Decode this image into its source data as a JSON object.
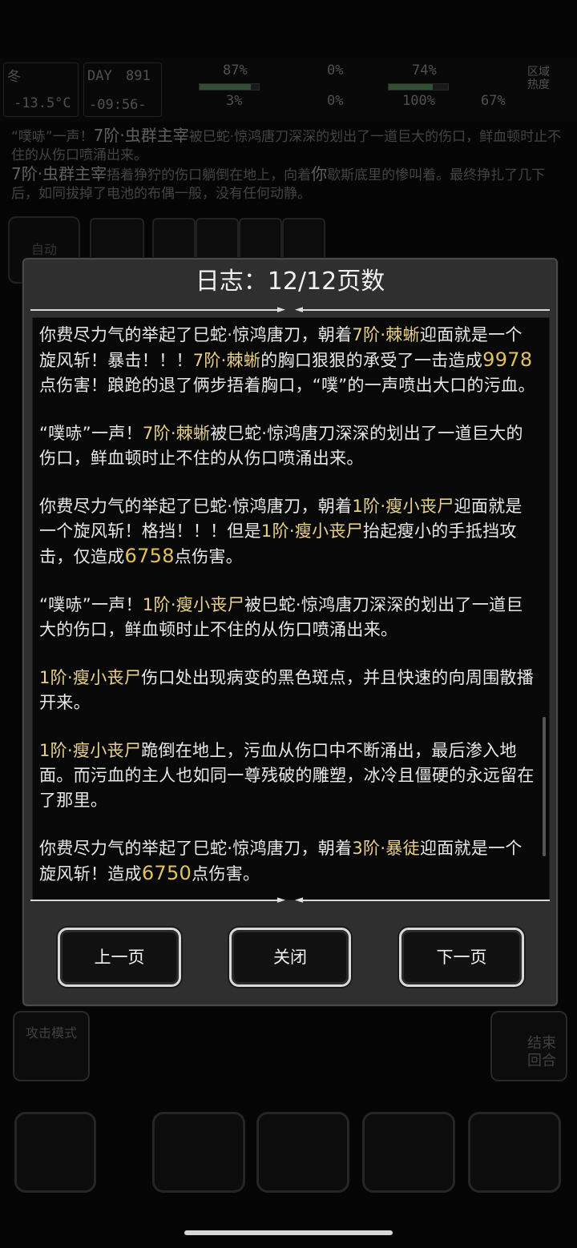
{
  "hud": {
    "temp_label": "冬",
    "temperature": "-13.5°C",
    "day_label": "DAY",
    "day": "891",
    "time": "-09:56-",
    "stats_top": [
      "87%",
      "0%",
      "74%"
    ],
    "stats_bottom": [
      "3%",
      "0%",
      "100%",
      "67%"
    ],
    "region_heat": "区域热度"
  },
  "background_log": {
    "line1_prefix": "“噗哧”一声！",
    "line1_name": "7阶·虫群主宰",
    "line1_rest": "被巳蛇·惊鸿唐刀深深的划出了一道巨大的伤口，鲜血顿时止不住的从伤口喷涌出来。",
    "line2_name": "7阶·虫群主宰",
    "line2_mid": "捂着狰狞的伤口躺倒在地上，向着",
    "line2_you": "你",
    "line2_rest": "歇斯底里的惨叫着。最终挣扎了几下后，如同拔掉了电池的布偶一般，没有任何动静。"
  },
  "side": {
    "auto": "自动",
    "attack_mode": "攻击模式",
    "end_turn": "结束回合"
  },
  "dialog": {
    "title": "日志：12/12页数",
    "entries": [
      {
        "a": "你费尽力气的举起了巳蛇·惊鸿唐刀，朝着",
        "b": "7阶·棘蜥",
        "c": "迎面就是一个旋风斩！暴击！！！",
        "d": "7阶·棘蜥",
        "e": "的胸口狠狠的承受了一击造成",
        "n": "9978",
        "f": "点伤害！踉跄的退了俩步捂着胸口，“噗”的一声喷出大口的污血。"
      },
      {
        "a": "“噗哧”一声！",
        "b": "7阶·棘蜥",
        "c": "被巳蛇·惊鸿唐刀深深的划出了一道巨大的伤口，鲜血顿时止不住的从伤口喷涌出来。"
      },
      {
        "a": "你费尽力气的举起了巳蛇·惊鸿唐刀，朝着",
        "b": "1阶·瘦小丧尸",
        "c": "迎面就是一个旋风斩！格挡！！！但是",
        "d": "1阶·瘦小丧尸",
        "e": "抬起瘦小的手抵挡攻击，仅造成",
        "n": "6758",
        "f": "点伤害。"
      },
      {
        "a": "“噗哧”一声！",
        "b": "1阶·瘦小丧尸",
        "c": "被巳蛇·惊鸿唐刀深深的划出了一道巨大的伤口，鲜血顿时止不住的从伤口喷涌出来。"
      },
      {
        "b": "1阶·瘦小丧尸",
        "c": "伤口处出现病变的黑色斑点，并且快速的向周围散播开来。"
      },
      {
        "b": "1阶·瘦小丧尸",
        "c": "跪倒在地上，污血从伤口中不断涌出，最后渗入地面。而污血的主人也如同一尊残破的雕塑，冰冷且僵硬的永远留在了那里。"
      },
      {
        "a": "你费尽力气的举起了巳蛇·惊鸿唐刀，朝着",
        "b": "3阶·暴徒",
        "c": "迎面就是一个旋风斩！造成",
        "n": "6750",
        "f": "点伤害。"
      }
    ],
    "prev_button": "上一页",
    "close_button": "关闭",
    "next_button": "下一页"
  },
  "colors": {
    "name_highlight": "#e8d08a",
    "damage_number": "#e2c25a",
    "dialog_bg": "#2f2f2f",
    "log_bg": "#080808"
  }
}
